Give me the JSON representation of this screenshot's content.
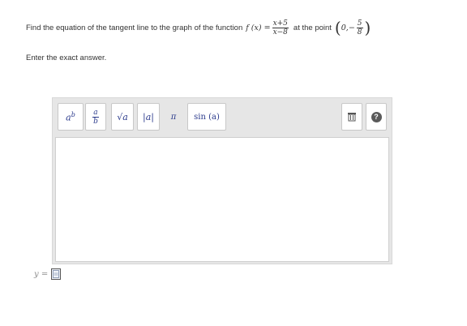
{
  "question": {
    "prefix": "Find the equation of the tangent line to the graph of the function",
    "func_lhs": "f (x) =",
    "func_num": "x+5",
    "func_den": "x−8",
    "middle": "at the point",
    "point_x": "0,",
    "point_sign": "−",
    "point_num": "5",
    "point_den": "8"
  },
  "instruction": "Enter the exact answer.",
  "toolbar": {
    "power": {
      "base": "a",
      "exp": "b"
    },
    "fraction": {
      "num": "a",
      "den": "b"
    },
    "sqrt": "√a",
    "abs": "|a|",
    "pi": "π",
    "sin": "sin (a)",
    "help": "?"
  },
  "answer": {
    "label": "y ="
  },
  "colors": {
    "toolbar_bg": "#e6e6e6",
    "accent": "#2b3a8c",
    "help_bg": "#5a5a5a"
  }
}
